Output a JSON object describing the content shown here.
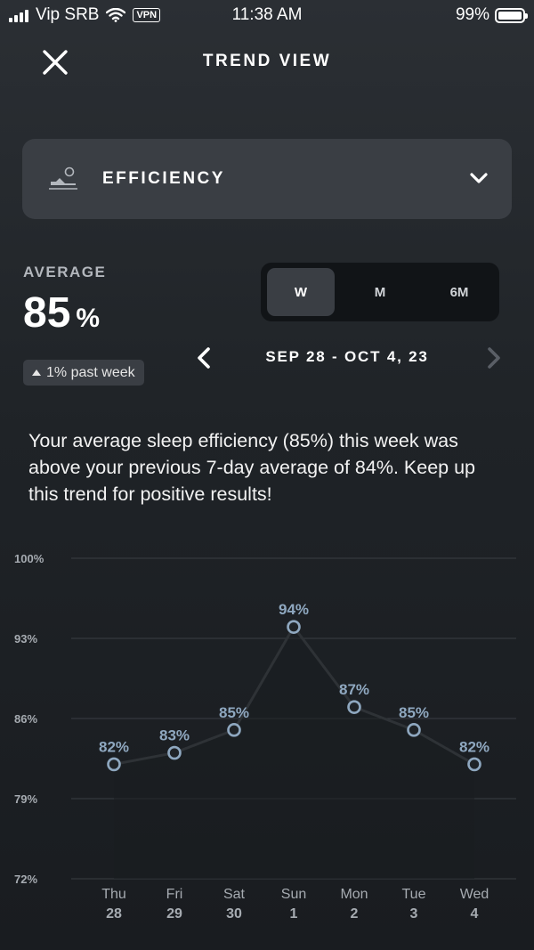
{
  "status_bar": {
    "carrier": "Vip SRB",
    "vpn_label": "VPN",
    "time": "11:38 AM",
    "battery_percent": "99%",
    "battery_level": 0.99
  },
  "header": {
    "title": "TREND VIEW",
    "close_icon": "close-icon"
  },
  "metric_selector": {
    "label": "EFFICIENCY",
    "icon": "sleep-person-icon",
    "chevron_icon": "chevron-down-icon"
  },
  "average": {
    "label": "AVERAGE",
    "value": "85",
    "unit": "%",
    "change": "1% past week"
  },
  "period_toggle": {
    "options": [
      "W",
      "M",
      "6M"
    ],
    "selected": "W"
  },
  "date_nav": {
    "range": "SEP 28 - OCT 4, 23"
  },
  "summary": {
    "text": "Your average sleep efficiency (85%) this week was above your previous 7-day average of 84%. Keep up this trend for positive results!"
  },
  "colors": {
    "line": "#2e3236",
    "point": "#8fa8c0",
    "point_label": "#8fa8c0",
    "grid": "#3a3e44",
    "tick": "#a6abb1"
  },
  "chart_data": {
    "type": "line",
    "y_ticks": [
      "100%",
      "93%",
      "86%",
      "79%",
      "72%"
    ],
    "ylim": [
      72,
      100
    ],
    "categories": [
      {
        "day": "Thu",
        "date": "28"
      },
      {
        "day": "Fri",
        "date": "29"
      },
      {
        "day": "Sat",
        "date": "30"
      },
      {
        "day": "Sun",
        "date": "1"
      },
      {
        "day": "Mon",
        "date": "2"
      },
      {
        "day": "Tue",
        "date": "3"
      },
      {
        "day": "Wed",
        "date": "4"
      }
    ],
    "values": [
      82,
      83,
      85,
      94,
      87,
      85,
      82
    ],
    "value_labels": [
      "82%",
      "83%",
      "85%",
      "94%",
      "87%",
      "85%",
      "82%"
    ],
    "grid": true
  }
}
